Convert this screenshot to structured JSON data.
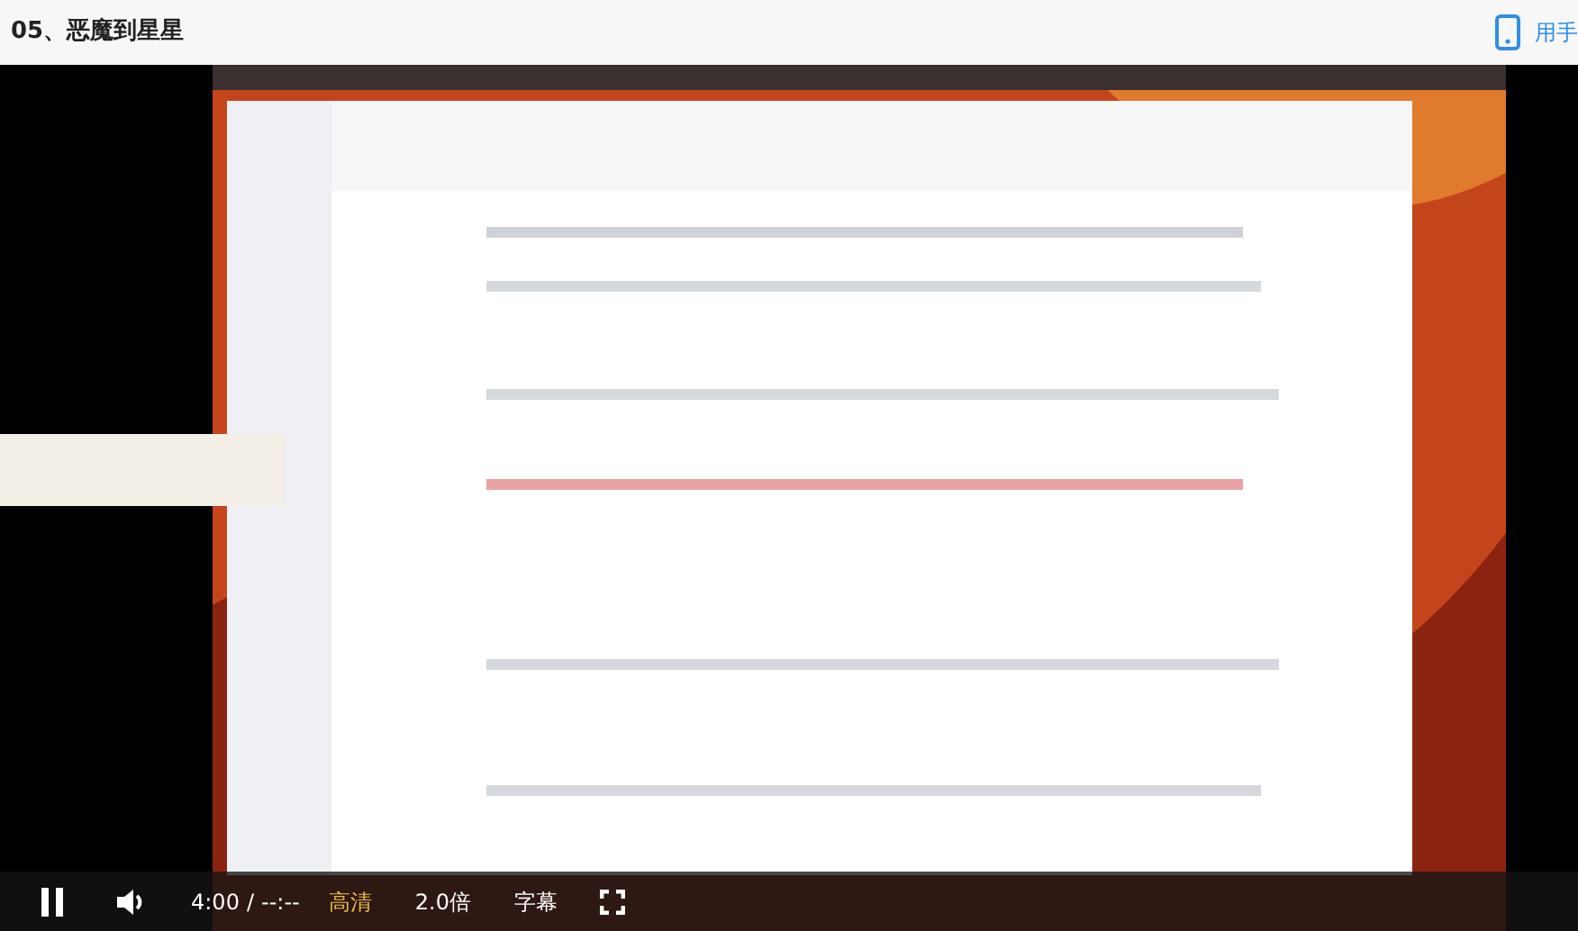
{
  "title": "05、恶魔到星星",
  "header_link": {
    "label": "用手"
  },
  "video": {
    "kind": "picture",
    "playing": true,
    "controls": {
      "time": "4:00",
      "separator": "/",
      "duration": "--:--",
      "quality": "高清",
      "speed": "2.0倍",
      "subtitles": "字幕"
    }
  }
}
